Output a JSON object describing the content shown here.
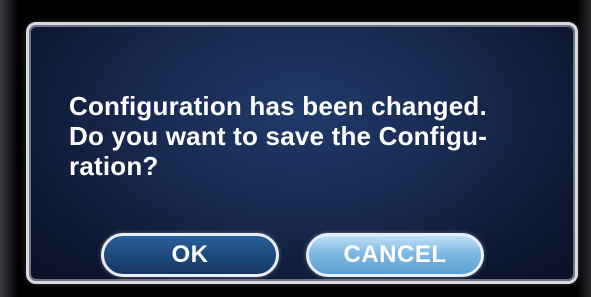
{
  "dialog": {
    "message": "Configuration has been changed.\nDo you want to save the Configu-\nration?",
    "buttons": {
      "ok_label": "OK",
      "cancel_label": "CANCEL"
    }
  },
  "colors": {
    "dialog_background": "#17284d",
    "dialog_border": "#d9dbe3",
    "ok_button": "#1d4a7f",
    "cancel_button": "#7fb9e2",
    "text": "#ffffff"
  }
}
